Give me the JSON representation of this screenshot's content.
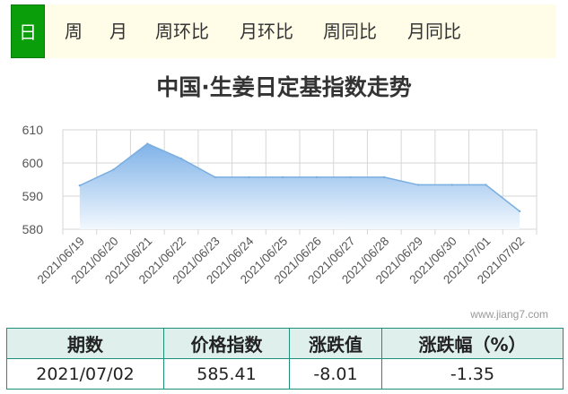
{
  "tabs": [
    {
      "label": "日",
      "active": true
    },
    {
      "label": "周"
    },
    {
      "label": "月"
    },
    {
      "label": "周环比"
    },
    {
      "label": "月环比"
    },
    {
      "label": "周同比"
    },
    {
      "label": "月同比"
    }
  ],
  "watermark": "www.jiang7.com",
  "summary": {
    "headers": [
      "期数",
      "价格指数",
      "涨跌值",
      "涨跌幅（%）"
    ],
    "row": [
      "2021/07/02",
      "585.41",
      "-8.01",
      "-1.35"
    ]
  },
  "chart_data": {
    "type": "area",
    "title": "中国·生姜日定基指数走势",
    "categories": [
      "2021/06/19",
      "2021/06/20",
      "2021/06/21",
      "2021/06/22",
      "2021/06/23",
      "2021/06/24",
      "2021/06/25",
      "2021/06/26",
      "2021/06/27",
      "2021/06/28",
      "2021/06/29",
      "2021/06/30",
      "2021/07/01",
      "2021/07/02"
    ],
    "values": [
      593.2,
      598.0,
      605.8,
      601.3,
      595.7,
      595.7,
      595.7,
      595.7,
      595.7,
      595.7,
      593.4,
      593.4,
      593.4,
      585.41
    ],
    "ylim": [
      580,
      610
    ],
    "yticks": [
      580,
      590,
      600,
      610
    ],
    "grid": true,
    "line_color": "#7aaee0",
    "fill_top": "#7fb2e8",
    "fill_bottom": "#f2f8fe"
  }
}
